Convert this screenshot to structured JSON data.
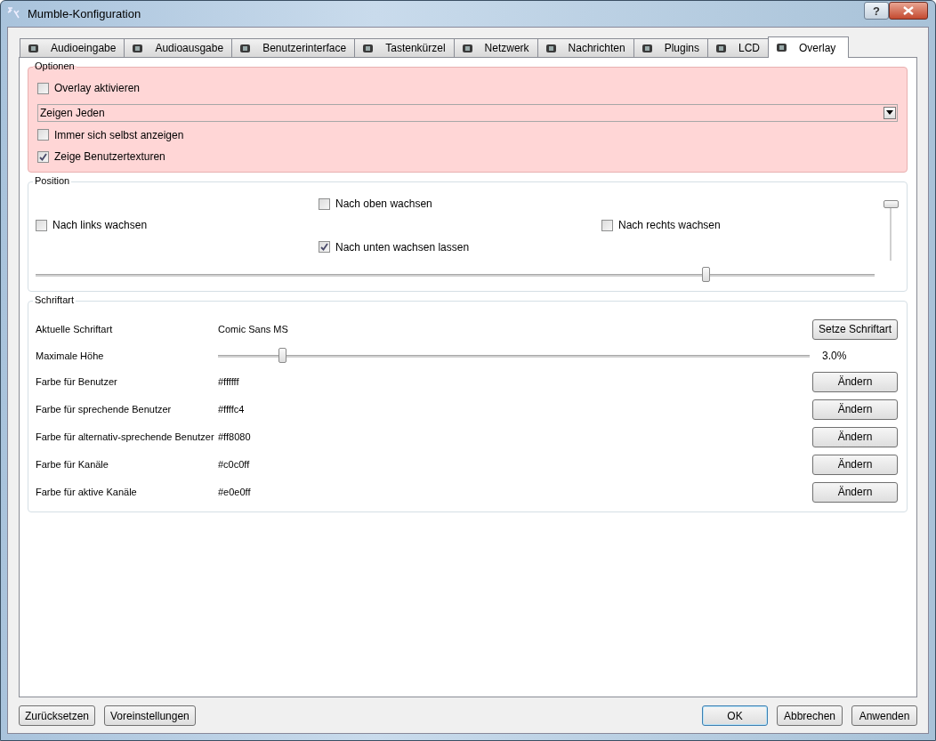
{
  "window": {
    "title": "Mumble-Konfiguration",
    "help": "?"
  },
  "tabs": [
    {
      "label": "Audioeingabe",
      "selected": false
    },
    {
      "label": "Audioausgabe",
      "selected": false
    },
    {
      "label": "Benutzerinterface",
      "selected": false
    },
    {
      "label": "Tastenkürzel",
      "selected": false
    },
    {
      "label": "Netzwerk",
      "selected": false
    },
    {
      "label": "Nachrichten",
      "selected": false
    },
    {
      "label": "Plugins",
      "selected": false
    },
    {
      "label": "LCD",
      "selected": false
    },
    {
      "label": "Overlay",
      "selected": true
    }
  ],
  "options": {
    "title": "Optionen",
    "items": [
      {
        "kind": "checkbox",
        "label": "Overlay aktivieren",
        "checked": false
      },
      {
        "kind": "dropdown",
        "value": "Zeigen Jeden"
      },
      {
        "kind": "checkbox",
        "label": "Immer sich selbst anzeigen",
        "checked": false
      },
      {
        "kind": "checkbox",
        "label": "Zeige Benutzertexturen",
        "checked": true
      }
    ]
  },
  "position": {
    "title": "Position",
    "grow_up": {
      "label": "Nach oben wachsen",
      "checked": false
    },
    "grow_left": {
      "label": "Nach links wachsen",
      "checked": false
    },
    "grow_right": {
      "label": "Nach rechts wachsen",
      "checked": false
    },
    "grow_down": {
      "label": "Nach unten wachsen lassen",
      "checked": true
    },
    "horizontal_slider": {
      "level": 0.8
    },
    "vertical_slider": {
      "level": 1
    }
  },
  "font": {
    "title": "Schriftart",
    "rows": [
      {
        "kind": "text",
        "label": "Aktuelle Schriftart",
        "value": "Comic Sans MS",
        "button": "Setze Schriftart"
      },
      {
        "kind": "slider",
        "label": "Maximale Höhe",
        "level": 0.11,
        "reading": "3.0%"
      },
      {
        "kind": "text",
        "label": "Farbe für Benutzer",
        "value": "#ffffff",
        "button": "Ändern"
      },
      {
        "kind": "text",
        "label": "Farbe für sprechende Benutzer",
        "value": "#ffffc4",
        "button": "Ändern"
      },
      {
        "kind": "text",
        "label": "Farbe für alternativ-sprechende Benutzer",
        "value": "#ff8080",
        "button": "Ändern"
      },
      {
        "kind": "text",
        "label": "Farbe für Kanäle",
        "value": "#c0c0ff",
        "button": "Ändern"
      },
      {
        "kind": "text",
        "label": "Farbe für aktive Kanäle",
        "value": "#e0e0ff",
        "button": "Ändern"
      }
    ]
  },
  "buttons_left": [
    "Zurücksetzen",
    "Voreinstellungen"
  ],
  "buttons_right": [
    {
      "label": "OK",
      "default": true
    },
    {
      "label": "Abbrechen",
      "default": false
    },
    {
      "label": "Anwenden",
      "default": false
    }
  ]
}
